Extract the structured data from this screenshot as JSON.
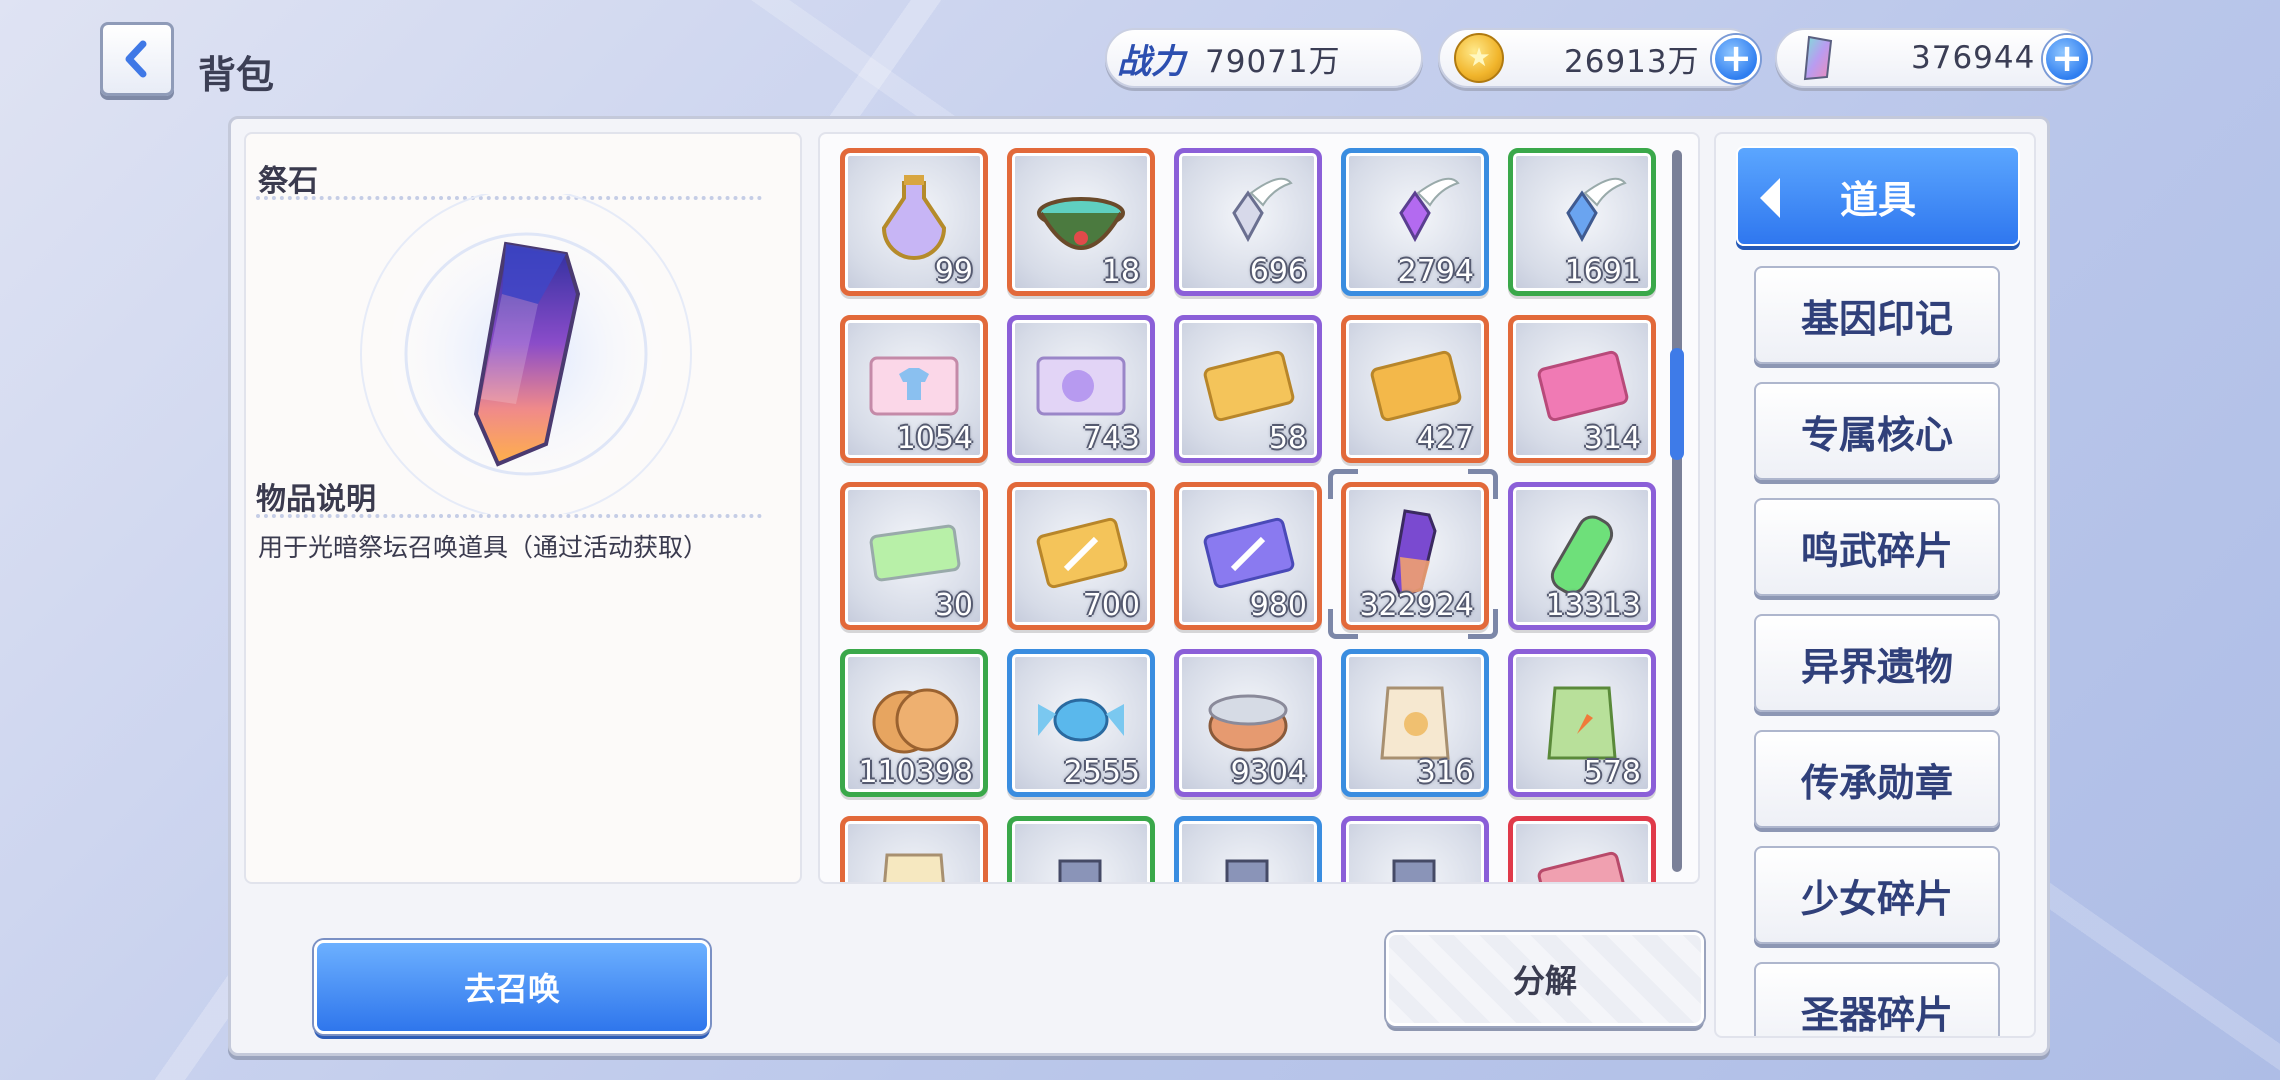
{
  "header": {
    "title": "背包",
    "power_label": "战力",
    "power_value": "79071万",
    "gold_value": "26913万",
    "gem_value": "376944"
  },
  "detail": {
    "item_name": "祭石",
    "desc_title": "物品说明",
    "desc_text": "用于光暗祭坛召唤道具（通过活动获取）"
  },
  "grid": {
    "items": [
      {
        "icon": "potion-bottle-icon",
        "rarity": "orange",
        "count": "99"
      },
      {
        "icon": "cauldron-icon",
        "rarity": "orange",
        "count": "18"
      },
      {
        "icon": "winged-crystal-silver-icon",
        "rarity": "purple",
        "count": "696"
      },
      {
        "icon": "winged-crystal-purple-icon",
        "rarity": "blue",
        "count": "2794"
      },
      {
        "icon": "winged-crystal-blue-icon",
        "rarity": "green",
        "count": "1691"
      },
      {
        "icon": "ticket-shirt-icon",
        "rarity": "orange",
        "count": "1054"
      },
      {
        "icon": "ticket-smile-icon",
        "rarity": "purple",
        "count": "743"
      },
      {
        "icon": "gene-card-gold-icon",
        "rarity": "purple",
        "count": "58"
      },
      {
        "icon": "card-gold-icon",
        "rarity": "orange",
        "count": "427"
      },
      {
        "icon": "gene-card-pink-icon",
        "rarity": "orange",
        "count": "314"
      },
      {
        "icon": "rainbow-ticket-icon",
        "rarity": "orange",
        "count": "30"
      },
      {
        "icon": "sword-card-gold-icon",
        "rarity": "orange",
        "count": "700"
      },
      {
        "icon": "sword-card-blue-icon",
        "rarity": "orange",
        "count": "980"
      },
      {
        "icon": "sacrifice-stone-icon",
        "rarity": "orange",
        "count": "322924",
        "selected": true
      },
      {
        "icon": "green-vial-icon",
        "rarity": "purple",
        "count": "13313"
      },
      {
        "icon": "cookie-icon",
        "rarity": "green",
        "count": "110398"
      },
      {
        "icon": "candy-icon",
        "rarity": "blue",
        "count": "2555"
      },
      {
        "icon": "canned-food-icon",
        "rarity": "purple",
        "count": "9304"
      },
      {
        "icon": "food-bag-icon",
        "rarity": "blue",
        "count": "316"
      },
      {
        "icon": "carrot-bag-icon",
        "rarity": "purple",
        "count": "578"
      },
      {
        "icon": "partial-bag-icon",
        "rarity": "orange",
        "count": ""
      },
      {
        "icon": "partial-gadget-icon",
        "rarity": "green",
        "count": ""
      },
      {
        "icon": "partial-gadget-icon",
        "rarity": "blue",
        "count": ""
      },
      {
        "icon": "partial-gadget-icon",
        "rarity": "purple",
        "count": ""
      },
      {
        "icon": "partial-card-icon",
        "rarity": "red",
        "count": ""
      }
    ]
  },
  "categories": {
    "active": "道具",
    "items": [
      "基因印记",
      "专属核心",
      "鸣武碎片",
      "异界遗物",
      "传承勋章",
      "少女碎片",
      "圣器碎片"
    ]
  },
  "buttons": {
    "summon": "去召唤",
    "split": "分解"
  },
  "colors": {
    "orange": "#e2693a",
    "purple": "#8b5fd8",
    "blue": "#3a8de0",
    "green": "#3aa84a",
    "red": "#e03a4a",
    "accent_blue": "#2f77ef"
  }
}
